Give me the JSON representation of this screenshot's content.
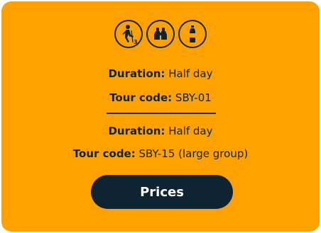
{
  "icons": [
    {
      "name": "hiking-difficulty-icon",
      "level": "3"
    },
    {
      "name": "binoculars-icon"
    },
    {
      "name": "water-bottle-icon"
    }
  ],
  "tours": [
    {
      "duration_label": "Duration:",
      "duration_value": "Half day",
      "code_label": "Tour code:",
      "code_value": "SBY-01"
    },
    {
      "duration_label": "Duration:",
      "duration_value": "Half day",
      "code_label": "Tour code:",
      "code_value": "SBY-15 (large group)"
    }
  ],
  "prices_button": {
    "label": "Prices"
  },
  "colors": {
    "card_background": "#ffa200",
    "dark": "#0e2433",
    "button_text": "#ffffff"
  }
}
